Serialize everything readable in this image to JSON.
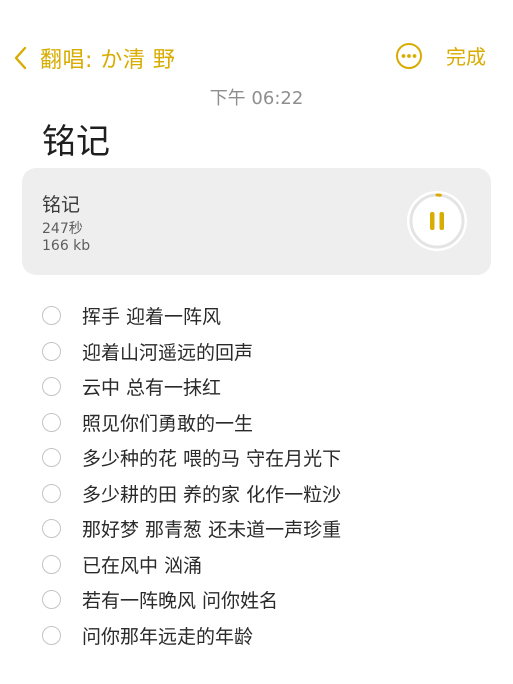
{
  "nav": {
    "back_label": "翻唱: か清 野",
    "done_label": "完成",
    "accent_color": "#d8ac00"
  },
  "note": {
    "timestamp": "下午 06:22",
    "title": "铭记"
  },
  "audio": {
    "name": "铭记",
    "duration": "247秒",
    "size": "166 kb",
    "state": "playing",
    "progress": 0.02
  },
  "checklist": [
    {
      "text": "挥手 迎着一阵风",
      "checked": false
    },
    {
      "text": "迎着山河遥远的回声",
      "checked": false
    },
    {
      "text": "云中 总有一抹红",
      "checked": false
    },
    {
      "text": "照见你们勇敢的一生",
      "checked": false
    },
    {
      "text": "多少种的花 喂的马 守在月光下",
      "checked": false
    },
    {
      "text": "多少耕的田 养的家 化作一粒沙",
      "checked": false
    },
    {
      "text": "那好梦 那青葱 还未道一声珍重",
      "checked": false
    },
    {
      "text": "已在风中 汹涌",
      "checked": false
    },
    {
      "text": "若有一阵晚风 问你姓名",
      "checked": false
    },
    {
      "text": "问你那年远走的年龄",
      "checked": false
    }
  ],
  "icons": {
    "back": "chevron-left-icon",
    "more": "more-horizontal-icon",
    "pause": "pause-icon",
    "check": "checkbox-circle-icon"
  }
}
